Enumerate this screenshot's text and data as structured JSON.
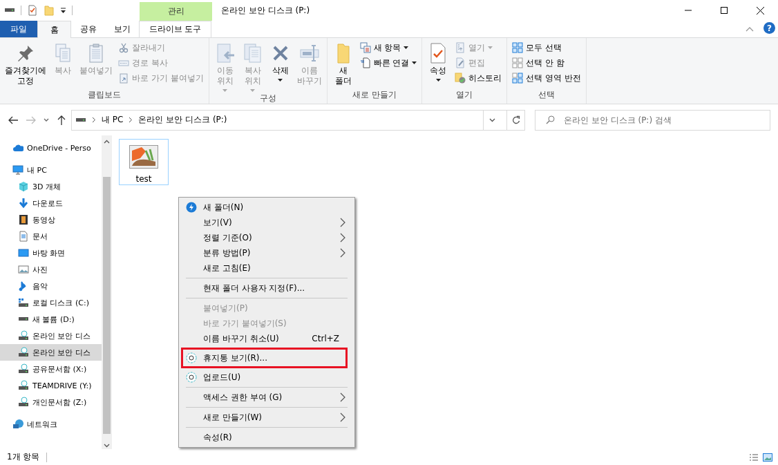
{
  "title_bar": {
    "context_tab_group": "관리",
    "title": "온라인 보안 디스크 (P:)"
  },
  "ribbon_tabs": [
    {
      "label": "파일",
      "kind": "file",
      "selected": false
    },
    {
      "label": "홈",
      "kind": "tab",
      "selected": true
    },
    {
      "label": "공유",
      "kind": "tab",
      "selected": false
    },
    {
      "label": "보기",
      "kind": "tab",
      "selected": false
    },
    {
      "label": "드라이브 도구",
      "kind": "context",
      "selected": false
    }
  ],
  "help_button": "?",
  "ribbon_groups": [
    {
      "label": "클립보드",
      "items": [
        {
          "kind": "large",
          "label": "즐겨찾기에\n고정",
          "disabled": false,
          "dropdown": false
        },
        {
          "kind": "large",
          "label": "복사",
          "disabled": true,
          "dropdown": false
        },
        {
          "kind": "large",
          "label": "붙여넣기",
          "disabled": true,
          "dropdown": false
        },
        {
          "kind": "small",
          "label": "잘라내기",
          "disabled": true,
          "dropdown": false
        },
        {
          "kind": "small",
          "label": "경로 복사",
          "disabled": true,
          "dropdown": false
        },
        {
          "kind": "small",
          "label": "바로 가기 붙여넣기",
          "disabled": true,
          "dropdown": false
        }
      ]
    },
    {
      "label": "구성",
      "items": [
        {
          "kind": "large",
          "label": "이동\n위치",
          "disabled": true,
          "dropdown": true
        },
        {
          "kind": "large",
          "label": "복사\n위치",
          "disabled": true,
          "dropdown": true
        },
        {
          "kind": "large",
          "label": "삭제",
          "disabled": false,
          "dropdown": true
        },
        {
          "kind": "large",
          "label": "이름\n바꾸기",
          "disabled": true,
          "dropdown": false
        }
      ]
    },
    {
      "label": "새로 만들기",
      "items": [
        {
          "kind": "large",
          "label": "새\n폴더",
          "disabled": false,
          "dropdown": false
        },
        {
          "kind": "small",
          "label": "새 항목",
          "disabled": false,
          "dropdown": true
        },
        {
          "kind": "small",
          "label": "빠른 연결",
          "disabled": false,
          "dropdown": true
        }
      ]
    },
    {
      "label": "열기",
      "items": [
        {
          "kind": "large",
          "label": "속성",
          "disabled": false,
          "dropdown": true
        },
        {
          "kind": "small",
          "label": "열기",
          "disabled": true,
          "dropdown": true
        },
        {
          "kind": "small",
          "label": "편집",
          "disabled": true,
          "dropdown": false
        },
        {
          "kind": "small",
          "label": "히스토리",
          "disabled": false,
          "dropdown": false
        }
      ]
    },
    {
      "label": "선택",
      "items": [
        {
          "kind": "small",
          "label": "모두 선택",
          "disabled": false,
          "dropdown": false
        },
        {
          "kind": "small",
          "label": "선택 안 함",
          "disabled": false,
          "dropdown": false
        },
        {
          "kind": "small",
          "label": "선택 영역 반전",
          "disabled": false,
          "dropdown": false
        }
      ]
    }
  ],
  "address_bar": {
    "breadcrumbs": [
      "내 PC",
      "온라인 보안 디스크 (P:)"
    ]
  },
  "search": {
    "placeholder": "온라인 보안 디스크 (P:) 검색"
  },
  "navigation": [
    {
      "label": "OneDrive - Perso",
      "selected": false
    },
    {
      "label": "내 PC",
      "selected": false,
      "children": [
        {
          "label": "3D 개체",
          "selected": false
        },
        {
          "label": "다운로드",
          "selected": false
        },
        {
          "label": "동영상",
          "selected": false
        },
        {
          "label": "문서",
          "selected": false
        },
        {
          "label": "바탕 화면",
          "selected": false
        },
        {
          "label": "사진",
          "selected": false
        },
        {
          "label": "음악",
          "selected": false
        },
        {
          "label": "로컬 디스크 (C:)",
          "selected": false
        },
        {
          "label": "새 볼륨 (D:)",
          "selected": false
        },
        {
          "label": "온라인 보안 디스",
          "selected": false
        },
        {
          "label": "온라인 보안 디스",
          "selected": true
        },
        {
          "label": "공유문서함 (X:)",
          "selected": false
        },
        {
          "label": "TEAMDRIVE (Y:)",
          "selected": false
        },
        {
          "label": "개인문서함 (Z:)",
          "selected": false
        }
      ]
    },
    {
      "label": "네트워크",
      "selected": false
    }
  ],
  "files": [
    {
      "name": "test",
      "selected": true
    }
  ],
  "context_menu": {
    "items": [
      {
        "kind": "item",
        "label": "새 폴더(N)",
        "disabled": false,
        "submenu": false,
        "highlighted": false
      },
      {
        "kind": "item",
        "label": "보기(V)",
        "disabled": false,
        "submenu": true,
        "highlighted": false
      },
      {
        "kind": "item",
        "label": "정렬 기준(O)",
        "disabled": false,
        "submenu": true,
        "highlighted": false
      },
      {
        "kind": "item",
        "label": "분류 방법(P)",
        "disabled": false,
        "submenu": true,
        "highlighted": false
      },
      {
        "kind": "item",
        "label": "새로 고침(E)",
        "disabled": false,
        "submenu": false,
        "highlighted": false
      },
      {
        "kind": "separator"
      },
      {
        "kind": "item",
        "label": "현재 폴더 사용자 지정(F)...",
        "disabled": false,
        "submenu": false,
        "highlighted": false
      },
      {
        "kind": "separator"
      },
      {
        "kind": "item",
        "label": "붙여넣기(P)",
        "disabled": true,
        "submenu": false,
        "highlighted": false
      },
      {
        "kind": "item",
        "label": "바로 가기 붙여넣기(S)",
        "disabled": true,
        "submenu": false,
        "highlighted": false
      },
      {
        "kind": "item",
        "label": "이름 바꾸기 취소(U)",
        "shortcut": "Ctrl+Z",
        "disabled": false,
        "submenu": false,
        "highlighted": false
      },
      {
        "kind": "item",
        "label": "휴지통 보기(R)...",
        "disabled": false,
        "submenu": false,
        "highlighted": true
      },
      {
        "kind": "item",
        "label": "업로드(U)",
        "disabled": false,
        "submenu": false,
        "highlighted": false
      },
      {
        "kind": "separator"
      },
      {
        "kind": "item",
        "label": "액세스 권한 부여 (G)",
        "disabled": false,
        "submenu": true,
        "highlighted": false
      },
      {
        "kind": "separator"
      },
      {
        "kind": "item",
        "label": "새로 만들기(W)",
        "disabled": false,
        "submenu": true,
        "highlighted": false
      },
      {
        "kind": "separator"
      },
      {
        "kind": "item",
        "label": "속성(R)",
        "disabled": false,
        "submenu": false,
        "highlighted": false
      }
    ]
  },
  "status_bar": {
    "item_count": "1개 항목"
  }
}
